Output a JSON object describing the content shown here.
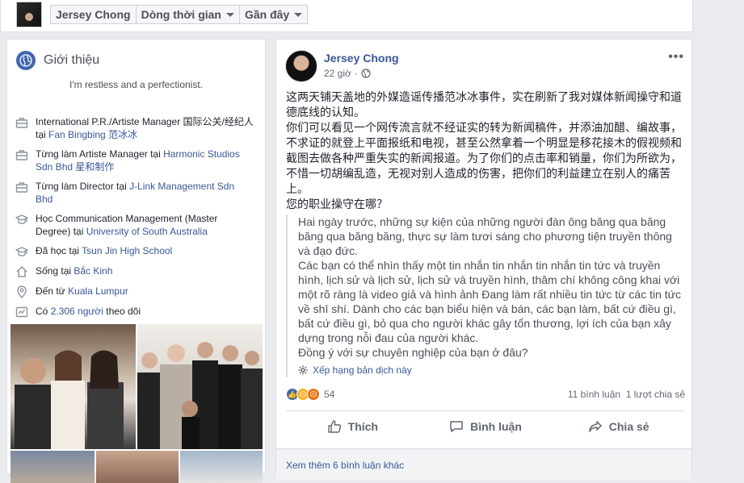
{
  "topbar": {
    "name": "Jersey Chong",
    "timeline": "Dòng thời gian",
    "recent": "Gần đây"
  },
  "intro": {
    "title": "Giới thiệu",
    "bio": "I'm restless and a perfectionist.",
    "items": [
      {
        "icon": "briefcase-icon",
        "pre": "International P.R./Artiste Manager 国际公关/经纪人 tại ",
        "link": "Fan Bingbing 范冰冰"
      },
      {
        "icon": "briefcase-icon",
        "pre": "Từng làm Artiste Manager tại ",
        "link": "Harmonic Studios Sdn Bhd 星和制作"
      },
      {
        "icon": "briefcase-icon",
        "pre": "Từng làm Director tại ",
        "link": "J-Link Management Sdn Bhd"
      },
      {
        "icon": "graduation-cap-icon",
        "pre": "Học Communication Management (Master Degree) tại ",
        "link": "University of South Australia"
      },
      {
        "icon": "graduation-cap-icon",
        "pre": "Đã học tại ",
        "link": "Tsun Jin High School"
      },
      {
        "icon": "home-icon",
        "pre": "Sống tại ",
        "link": "Bắc Kinh"
      },
      {
        "icon": "location-pin-icon",
        "pre": "Đến từ ",
        "link": "Kuala Lumpur"
      },
      {
        "icon": "followers-icon",
        "pre": "Có ",
        "link": "2.306 người",
        "post": " theo dõi"
      }
    ]
  },
  "post": {
    "author": "Jersey Chong",
    "time": "22 giờ",
    "paragraphs": [
      "这两天铺天盖地的外媒造谣传播范冰冰事件，实在刷新了我对媒体新闻操守和道德底线的认知。",
      "你们可以看见一个网传流言就不经证实的转为新闻稿件，并添油加醋、编故事，不求证的就登上平面报纸和电视，甚至公然拿着一个明显是移花接木的假视频和截图去做各种严重失实的新闻报道。为了你们的点击率和销量，你们为所欲为，不惜一切胡编乱造，无视对别人造成的伤害，把你们的利益建立在别人的痛苦上。",
      "您的职业操守在哪？"
    ],
    "translation": [
      "Hai ngày trước, những sự kiện của những người đàn ông băng qua băng băng qua băng băng, thực sự làm tươi sáng cho phương tiện truyền thông và đạo đức.",
      "Các bạn có thể nhìn thấy một tin nhắn tin nhắn tin nhắn tin tức và truyền hình, lịch sử và lịch sử, lịch sử và truyền hình, thâm chí không công khai với một rõ ràng là video giả và hình ảnh Đang làm rất nhiều tin tức từ các tin tức về shī shí. Dành cho các bạn biểu hiện và bán, các bạn làm, bất cứ điều gì, bất cứ điều gì, bỏ qua cho người khác gây tổn thương, lợi ích của bạn xây dựng trong nỗi đau của người khác.",
      "Đồng ý với sự chuyên nghiệp của bạn ở đâu?"
    ],
    "rate_translation": "Xếp hạng bản dịch này",
    "reaction_count": "54",
    "comments_count": "11 bình luận",
    "shares_count": "1 lượt chia sẻ",
    "like_label": "Thích",
    "comment_label": "Bình luận",
    "share_label": "Chia sẻ",
    "more_comments": "Xem thêm 6 bình luận khác"
  },
  "colors": {
    "link": "#385898",
    "brand": "#4267b2",
    "background": "#e9ebee"
  }
}
